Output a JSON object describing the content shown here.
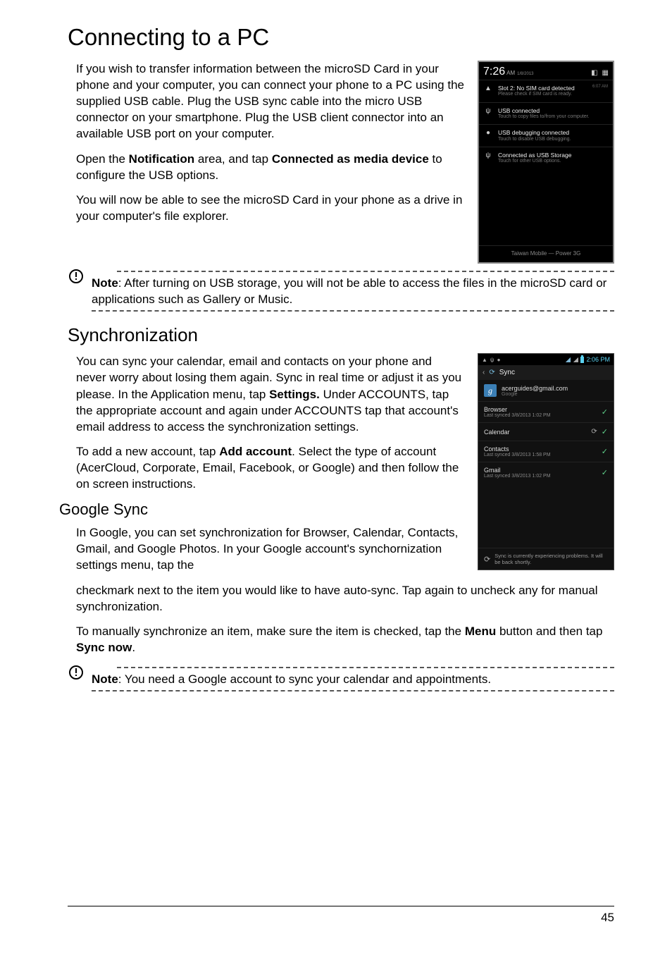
{
  "page_number": "45",
  "h1": "Connecting to a PC",
  "p1": "If you wish to transfer information between the microSD Card in your phone and your computer, you can connect your phone to a PC using the supplied USB cable. Plug the USB sync cable into the micro USB connector on your smartphone. Plug the USB client connector into an available USB port on your computer.",
  "p2_a": "Open the ",
  "p2_b": "Notification",
  "p2_c": " area, and tap ",
  "p2_d": "Connected as media device",
  "p2_e": " to configure the USB options.",
  "p3": "You will now be able to see the microSD Card in your phone as a drive in your computer's file explorer.",
  "note1_label": "Note",
  "note1_text": ": After turning on USB storage, you will not be able to access the files in the microSD card or applications such as Gallery or Music.",
  "h2": "Synchronization",
  "p4_a": "You can sync your calendar, email and contacts on your phone and never worry about losing them again. Sync in real time or adjust it as you please. In the Application menu, tap ",
  "p4_b": "Settings.",
  "p4_c": " Under ACCOUNTS, tap the appropriate account and again under ACCOUNTS tap that account's email address to access the synchronization settings.",
  "p5_a": "To add a new account, tap ",
  "p5_b": "Add account",
  "p5_c": ". Select the type of account (AcerCloud, Corporate, Email, Facebook, or Google) and then follow the on screen instructions.",
  "h3": "Google Sync",
  "p6": "In Google, you can set synchronization for Browser, Calendar, Contacts, Gmail, and Google Photos. In your Google account's synchornization settings menu, tap the",
  "p6b": "checkmark next to the item you would like to have auto-sync. Tap again to uncheck any for manual synchronization.",
  "p7_a": "To manually synchronize an item, make sure the item is checked, tap the ",
  "p7_b": "Menu",
  "p7_c": " button and then tap ",
  "p7_d": "Sync now",
  "p7_e": ".",
  "note2_label": "Note",
  "note2_text": ": You need a Google account to sync your calendar and appointments.",
  "shot1": {
    "time": "7:26",
    "ampm": "AM",
    "date": "1/8/2013",
    "rows": [
      {
        "icon": "▲",
        "title": "Slot 2: No SIM card detected",
        "sub": "Please check if SIM card is ready.",
        "ts": "6:07 AM"
      },
      {
        "icon": "ψ",
        "title": "USB connected",
        "sub": "Touch to copy files to/from your computer."
      },
      {
        "icon": "●",
        "title": "USB debugging connected",
        "sub": "Touch to disable USB debugging."
      },
      {
        "icon": "ψ",
        "title": "Connected as USB Storage",
        "sub": "Touch for other USB options."
      }
    ],
    "carrier": "Taiwan Mobile — Power 3G"
  },
  "shot2": {
    "clock": "2:06 PM",
    "header": "Sync",
    "account_name": "acerguides@gmail.com",
    "account_sub": "Google",
    "items": [
      {
        "title": "Browser",
        "sub": "Last synced 3/8/2013 1:02 PM",
        "sync": false,
        "check": true
      },
      {
        "title": "Calendar",
        "sub": "",
        "sync": true,
        "check": true
      },
      {
        "title": "Contacts",
        "sub": "Last synced 3/8/2013 1:58 PM",
        "sync": false,
        "check": true
      },
      {
        "title": "Gmail",
        "sub": "Last synced 3/8/2013 1:02 PM",
        "sync": false,
        "check": true
      }
    ],
    "footer": "Sync is currently experiencing problems. It will be back shortly."
  }
}
